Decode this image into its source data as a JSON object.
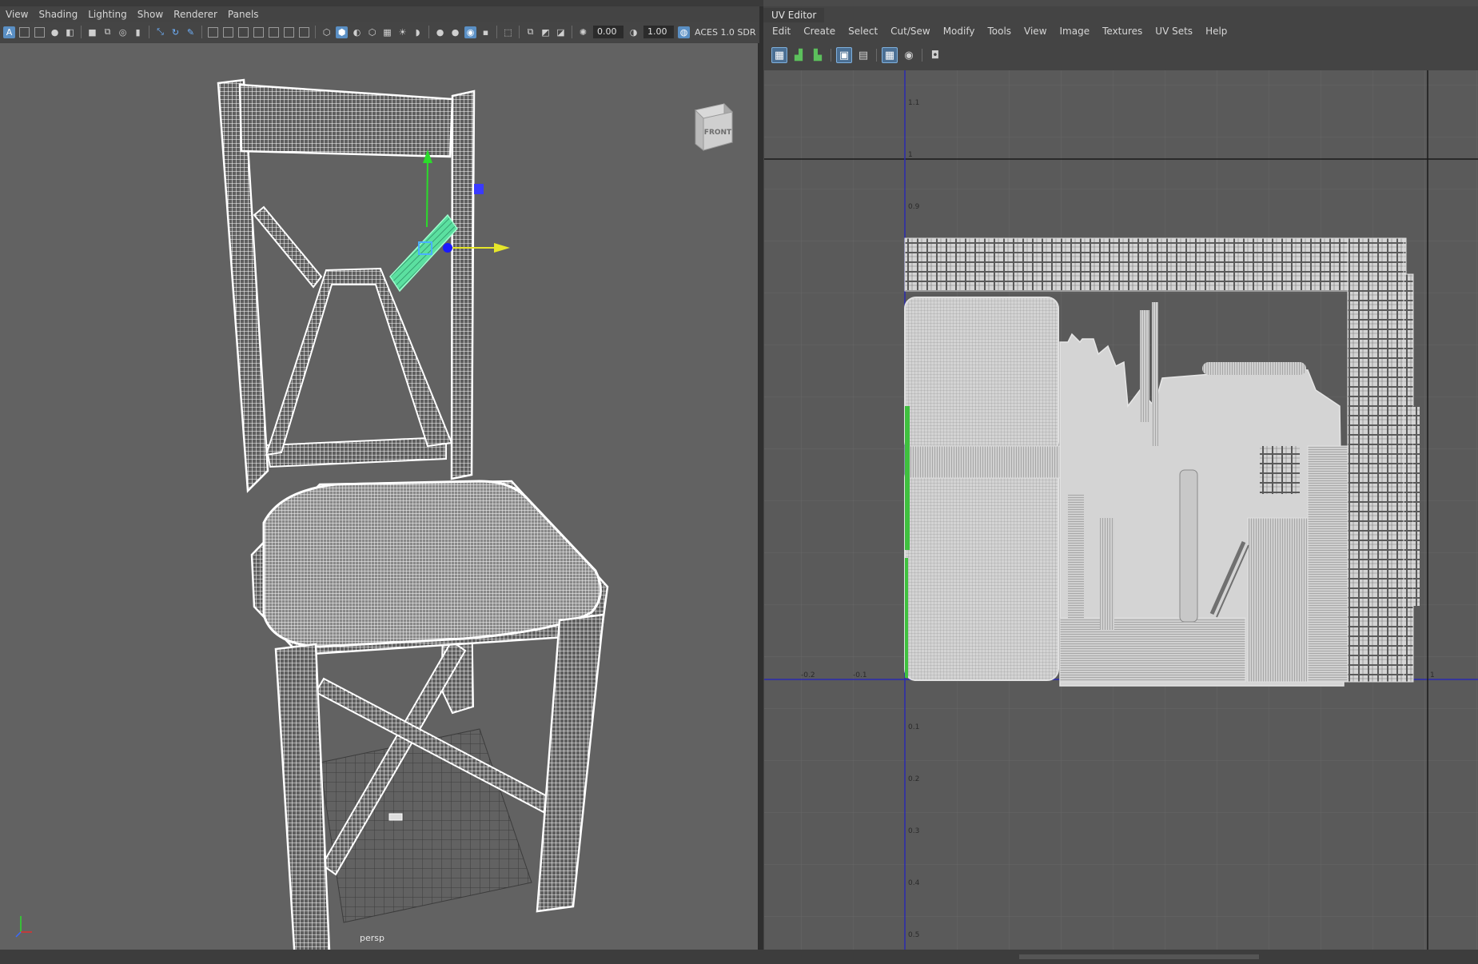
{
  "viewport_panel": {
    "menus": [
      "View",
      "Shading",
      "Lighting",
      "Show",
      "Renderer",
      "Panels"
    ],
    "toolbar": {
      "exposure_value": "0.00",
      "gamma_value": "1.00",
      "color_transform": "ACES 1.0 SDR"
    },
    "camera_label": "persp",
    "view_cube_label": "FRONT"
  },
  "uv_editor": {
    "title": "UV Editor",
    "menus": [
      "Edit",
      "Create",
      "Select",
      "Cut/Sew",
      "Modify",
      "Tools",
      "View",
      "Image",
      "Textures",
      "UV Sets",
      "Help"
    ],
    "v_labels": [
      "1.1",
      "1",
      "0.9",
      "0.1",
      "0.2",
      "0.3",
      "0.4",
      "0.5"
    ],
    "u_labels": [
      "-0.2",
      "-0.1",
      "1"
    ]
  },
  "colors": {
    "viewport_bg": "#626262",
    "uv_bg": "#5a5a5a",
    "panel_bg": "#444444",
    "wireframe": "#ffffff",
    "selected": "#5be0a0",
    "axis_y": "#2bdc2b",
    "axis_x": "#e6e62a",
    "axis_z": "#3a3aff",
    "uv_shell_fill": "#d4d4d4",
    "uv_axis_blue": "#2a2ab0"
  },
  "icons": {
    "viewport_toolbar": [
      "select-camera-icon",
      "camera-attributes-icon",
      "bookmark-icon",
      "image-plane-icon",
      "grid-icon",
      "film-gate-icon",
      "resolution-gate-icon",
      "gate-mask-icon",
      "field-chart-icon",
      "safe-action-icon",
      "wireframe-icon",
      "smooth-shade-icon",
      "wireframe-on-shaded-icon",
      "textured-icon",
      "lights-icon",
      "shadows-icon",
      "ambient-occlusion-icon",
      "motion-blur-icon",
      "isolate-select-icon",
      "xray-icon",
      "exposure-icon",
      "gamma-icon",
      "color-management-icon"
    ],
    "uv_toolbar": [
      "uv-shell-icon",
      "uv-distortion-icon",
      "uv-checker-icon",
      "uv-border-icon",
      "uv-grid-icon",
      "image-display-icon",
      "snapshot-icon"
    ]
  }
}
